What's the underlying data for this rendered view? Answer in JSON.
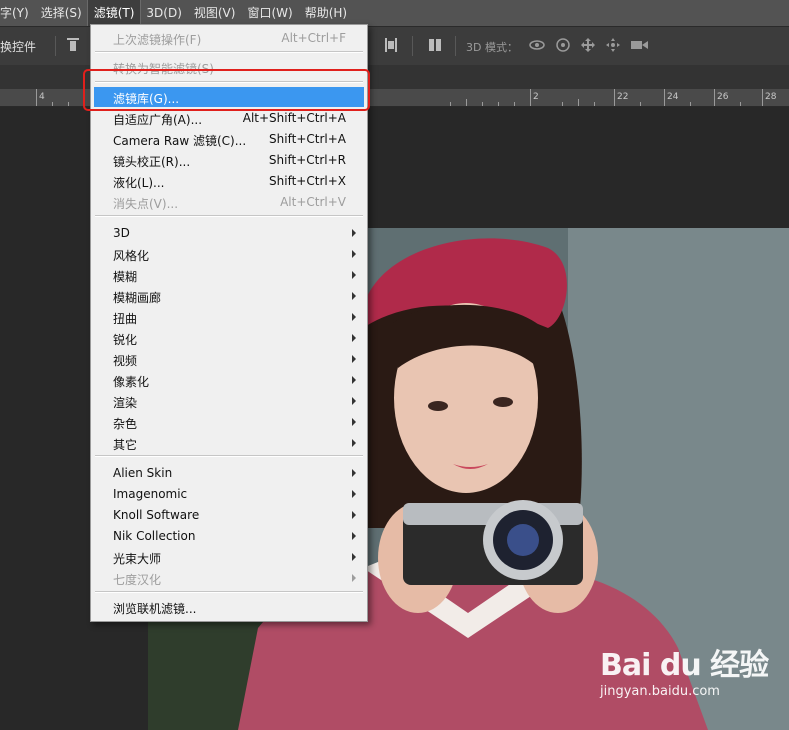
{
  "menubar": {
    "items": [
      "字(Y)",
      "选择(S)",
      "滤镜(T)",
      "3D(D)",
      "视图(V)",
      "窗口(W)",
      "帮助(H)"
    ]
  },
  "optbar": {
    "label": "换控件",
    "mode_label": "3D 模式："
  },
  "ruler": {
    "labels": [
      "4",
      "2",
      "22",
      "24",
      "26",
      "28"
    ]
  },
  "filter_menu": {
    "last_filter": {
      "label": "上次滤镜操作(F)",
      "shortcut": "Alt+Ctrl+F"
    },
    "smart_filter": {
      "label": "转换为智能滤镜(S)"
    },
    "gallery": {
      "label": "滤镜库(G)..."
    },
    "adaptive_wide": {
      "label": "自适应广角(A)...",
      "shortcut": "Alt+Shift+Ctrl+A"
    },
    "camera_raw": {
      "label": "Camera Raw 滤镜(C)...",
      "shortcut": "Shift+Ctrl+A"
    },
    "lens_correction": {
      "label": "镜头校正(R)...",
      "shortcut": "Shift+Ctrl+R"
    },
    "liquify": {
      "label": "液化(L)...",
      "shortcut": "Shift+Ctrl+X"
    },
    "vanishing_point": {
      "label": "消失点(V)...",
      "shortcut": "Alt+Ctrl+V"
    },
    "submenus": [
      "3D",
      "风格化",
      "模糊",
      "模糊画廊",
      "扭曲",
      "锐化",
      "视频",
      "像素化",
      "渲染",
      "杂色",
      "其它"
    ],
    "plugins": [
      "Alien Skin",
      "Imagenomic",
      "Knoll Software",
      "Nik Collection",
      "光束大师"
    ],
    "plugins_disabled": "七度汉化",
    "browse_online": "浏览联机滤镜..."
  },
  "watermark": {
    "brand": "Bai du 经验",
    "url": "jingyan.baidu.com"
  },
  "colors": {
    "highlight": "#3b97f0",
    "annotation_box": "#e0201c"
  }
}
